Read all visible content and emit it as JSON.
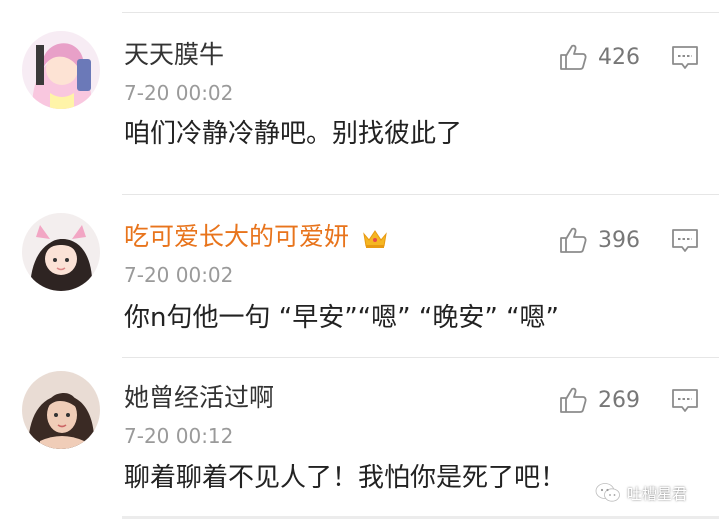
{
  "comments": [
    {
      "username": "天天膜牛",
      "time": "7-20 00:02",
      "text": "咱们冷静冷静吧。别找彼此了",
      "likes": "426"
    },
    {
      "username": "吃可爱长大的可爱妍",
      "time": "7-20 00:02",
      "text": "你n句他一句 “早安”“嗯” “晚安” “嗯”",
      "likes": "396",
      "badge": "crown-icon"
    },
    {
      "username": "她曾经活过啊",
      "time": "7-20 00:12",
      "text": "聊着聊着不见人了！我怕你是死了吧！",
      "likes": "269"
    }
  ],
  "watermark": "吐槽星君",
  "colors": {
    "vip_username": "#e8741c",
    "icon_gray": "#8c8c8c",
    "time_gray": "#9a9a9a"
  }
}
